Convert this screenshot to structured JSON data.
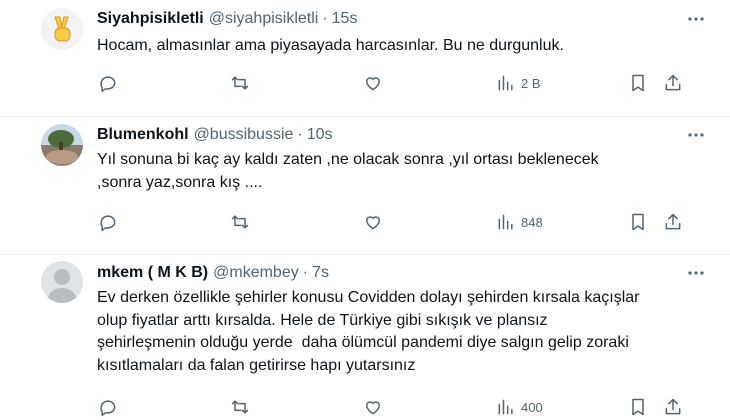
{
  "tweets": [
    {
      "name": "Siyahpisikletli",
      "handle": "@siyahpisikletli",
      "separator": "·",
      "time": "15s",
      "text": "Hocam, almasınlar ama piyasayada harcasınlar. Bu ne durgunluk.",
      "avatar_icon": "victory-hand-emoji",
      "views": "2 B"
    },
    {
      "name": "Blumenkohl",
      "handle": "@bussibussie",
      "separator": "·",
      "time": "10s",
      "text": "Yıl sonuna bi kaç ay kaldı zaten ,ne olacak sonra ,yıl ortası beklenecek\n,sonra yaz,sonra kış ....",
      "avatar_icon": "tree-photo",
      "views": "848"
    },
    {
      "name": "mkem ( M K B)",
      "handle": "@mkembey",
      "separator": "·",
      "time": "7s",
      "text": "Ev derken özellikle şehirler konusu Covidden dolayı şehirden kırsala kaçışlar\nolup fiyatlar arttı kırsalda. Hele de Türkiye gibi sıkışık ve plansız\nşehirleşmenin olduğu yerde  daha ölümcül pandemi diye salgın gelip zoraki\nkısıtlamaları da falan getirirse hapı yutarsınız",
      "avatar_icon": "default-avatar",
      "views": "400"
    }
  ],
  "icons": {
    "reply": "reply-icon",
    "retweet": "retweet-icon",
    "like": "heart-icon",
    "views": "views-icon",
    "bookmark": "bookmark-icon",
    "share": "share-icon",
    "more": "more-icon"
  }
}
